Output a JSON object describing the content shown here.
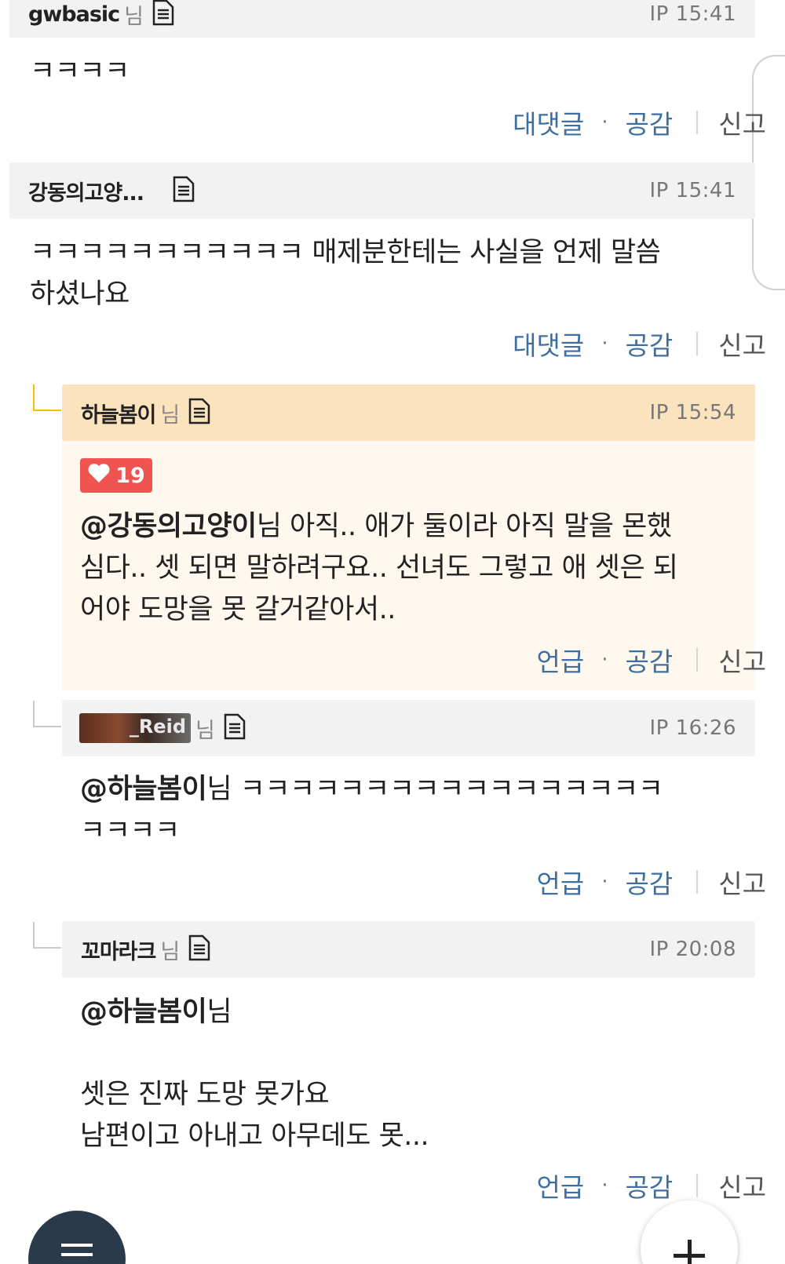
{
  "comments": [
    {
      "nick": "gwbasic",
      "nim": "님",
      "time": "IP 15:41",
      "body": "ㅋㅋㅋㅋ",
      "actions": {
        "reply": "대댓글",
        "dot": "·",
        "like": "공감",
        "report": "신고"
      }
    },
    {
      "nick": "강동의고양...",
      "nim": "",
      "time": "IP 15:41",
      "body_line1": "ㅋㅋㅋㅋㅋㅋㅋㅋㅋㅋㅋ 매제분한테는 사실을 언제 말씀",
      "body_line2": "하셨나요",
      "actions": {
        "reply": "대댓글",
        "dot": "·",
        "like": "공감",
        "report": "신고"
      }
    },
    {
      "nick": "하늘봄이",
      "nim": "님",
      "time": "IP 15:54",
      "likes": "19",
      "mention": "@강동의고양이",
      "mention_suffix": "님 아직.. 애가 둘이라 아직 말을 몬했",
      "body_line2": "심다.. 셋 되면 말하려구요.. 선녀도 그렇고 애 셋은 되",
      "body_line3": "어야 도망을 못 갈거같아서..",
      "actions": {
        "reply": "언급",
        "dot": "·",
        "like": "공감",
        "report": "신고"
      }
    },
    {
      "nick_image_text": "_Reid",
      "nim": "님",
      "time": "IP 16:26",
      "mention": "@하늘봄이",
      "mention_suffix": "님 ㅋㅋㅋㅋㅋㅋㅋㅋㅋㅋㅋㅋㅋㅋㅋㅋㅋ",
      "body_line2": "ㅋㅋㅋㅋ",
      "actions": {
        "reply": "언급",
        "dot": "·",
        "like": "공감",
        "report": "신고"
      }
    },
    {
      "nick": "꼬마라크",
      "nim": "님",
      "time": "IP 20:08",
      "mention": "@하늘봄이",
      "mention_suffix": "님",
      "body_line2": "셋은 진짜 도망 못가요",
      "body_line3": "남편이고 아내고 아무데도 못...",
      "actions": {
        "reply": "언급",
        "dot": "·",
        "like": "공감",
        "report": "신고"
      }
    }
  ],
  "icons": {
    "document": "document-icon",
    "heart": "heart-icon",
    "menu": "menu-icon",
    "plus": "plus-icon"
  },
  "colors": {
    "accent_link": "#3f6fa0",
    "highlight_header": "#fbe3be",
    "highlight_body": "#fff8ee",
    "badge": "#ef5450",
    "reply_line_gold": "#f2c200"
  }
}
